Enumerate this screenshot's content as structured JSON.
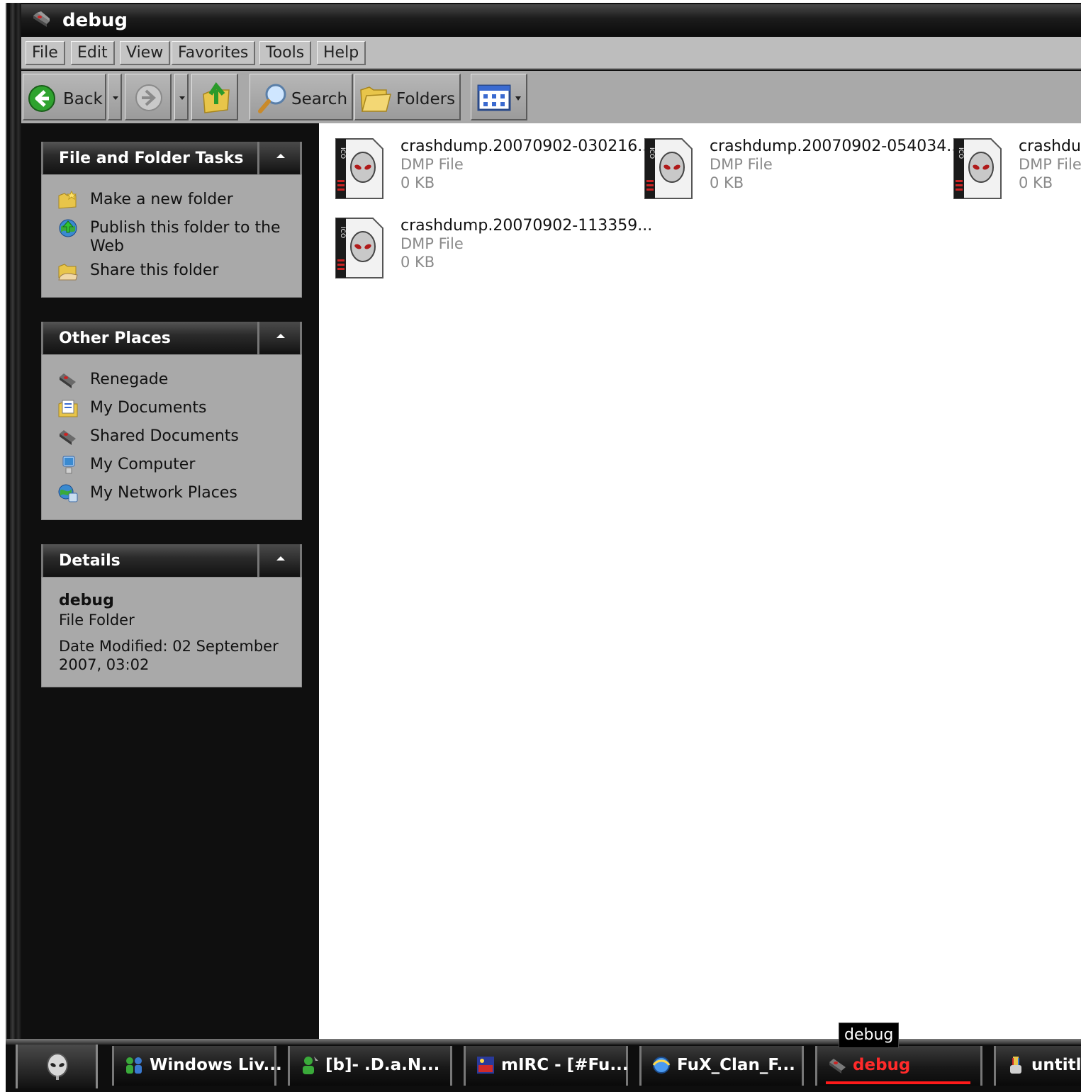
{
  "window": {
    "title": "debug",
    "icon": "folder-alien-icon"
  },
  "menu": [
    "File",
    "Edit",
    "View",
    "Favorites",
    "Tools",
    "Help"
  ],
  "toolbar": {
    "back_label": "Back",
    "search_label": "Search",
    "folders_label": "Folders"
  },
  "panels": {
    "tasks": {
      "title": "File and Folder Tasks",
      "items": [
        {
          "label": "Make a new folder",
          "icon": "new-folder-icon"
        },
        {
          "label": "Publish this folder to the Web",
          "icon": "publish-web-icon"
        },
        {
          "label": "Share this folder",
          "icon": "share-folder-icon"
        }
      ]
    },
    "places": {
      "title": "Other Places",
      "items": [
        {
          "label": "Renegade",
          "icon": "folder-icon"
        },
        {
          "label": "My Documents",
          "icon": "my-documents-icon"
        },
        {
          "label": "Shared Documents",
          "icon": "shared-documents-icon"
        },
        {
          "label": "My Computer",
          "icon": "my-computer-icon"
        },
        {
          "label": "My Network Places",
          "icon": "network-places-icon"
        }
      ]
    },
    "details": {
      "title": "Details",
      "name": "debug",
      "type": "File Folder",
      "modified": "Date Modified: 02 September 2007, 03:02"
    }
  },
  "files": [
    {
      "name": "crashdump.20070902-030216...",
      "type": "DMP File",
      "size": "0 KB"
    },
    {
      "name": "crashdump.20070902-054034...",
      "type": "DMP File",
      "size": "0 KB"
    },
    {
      "name": "crashdum",
      "type": "DMP File",
      "size": "0 KB"
    },
    {
      "name": "crashdump.20070902-113359...",
      "type": "DMP File",
      "size": "0 KB"
    }
  ],
  "file_icon_text": "ICO",
  "tooltip": "debug",
  "taskbar": [
    {
      "label": "Windows Liv...",
      "icon": "messenger-icon"
    },
    {
      "label": "[b]-   .D.a.N...",
      "icon": "contact-icon"
    },
    {
      "label": "mIRC - [#Fu...",
      "icon": "mirc-icon"
    },
    {
      "label": "FuX_Clan_F...",
      "icon": "browser-icon"
    },
    {
      "label": "debug",
      "icon": "folder-icon",
      "active": true
    },
    {
      "label": "untitl",
      "icon": "paint-icon"
    }
  ],
  "colors": {
    "accent_red": "#ff2a2a",
    "panel_bg": "#a9a9a9",
    "window_bg": "#0f0f0f"
  }
}
